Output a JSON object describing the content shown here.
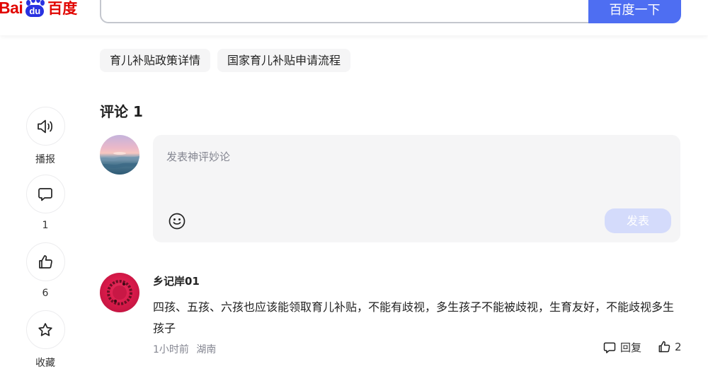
{
  "header": {
    "logo_text_bai": "Bai",
    "logo_text_du": "du",
    "logo_text_cn": "百度",
    "search_value": "",
    "search_button": "百度一下"
  },
  "related_tags": [
    "育儿补贴政策详情",
    "国家育儿补贴申请流程"
  ],
  "side_actions": {
    "play_label": "播报",
    "comment_count": "1",
    "like_count": "6",
    "favorite_label": "收藏"
  },
  "comments": {
    "title": "评论 1",
    "editor_placeholder": "发表神评妙论",
    "submit_label": "发表",
    "items": [
      {
        "user": "乡记岸01",
        "text": "四孩、五孩、六孩也应该能领取育儿补贴，不能有歧视，多生孩子不能被歧视，生育友好，不能歧视多生孩子",
        "time": "1小时前",
        "location": "湖南",
        "reply_label": "回复",
        "likes": "2"
      }
    ]
  },
  "colors": {
    "brand_blue": "#4e6ef2",
    "logo_red": "#e10601",
    "logo_blue": "#2932e1",
    "submit_disabled": "#d4dbfb",
    "panel_gray": "#f5f5f6"
  },
  "icons": [
    "speaker-icon",
    "comment-icon",
    "thumbs-up-icon",
    "star-icon",
    "emoji-icon"
  ]
}
